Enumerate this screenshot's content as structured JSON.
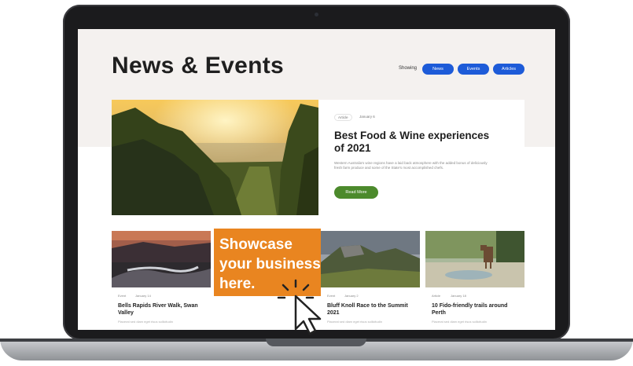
{
  "page": {
    "title": "News & Events",
    "filter": {
      "label": "Showing",
      "options": [
        "News",
        "Events",
        "Articles"
      ]
    }
  },
  "featured": {
    "tag": "Article",
    "date": "January 6",
    "title": "Best Food & Wine experiences of 2021",
    "description": "Western Australia's wine regions have a laid back atmosphere with the added bonus of deliciously fresh farm produce and some of the State's most accomplished chefs.",
    "button": "Read More"
  },
  "cards": [
    {
      "tag": "Event",
      "date": "January 14",
      "title": "Bells Rapids River Walk, Swan Valley",
      "desc": "Placerat sed diam eget risus sollicitudin"
    },
    {
      "tag": "Event",
      "date": "January 2",
      "title": "Bluff Knoll Race to the Summit 2021",
      "desc": "Placerat sed diam eget risus sollicitudin"
    },
    {
      "tag": "Article",
      "date": "January 18",
      "title": "10 Fido-friendly trails around Perth",
      "desc": "Placerat sed diam eget risus sollicitudin"
    }
  ],
  "promo": {
    "text": "Showcase your business here."
  },
  "colors": {
    "pill_blue": "#1d5bd8",
    "button_green": "#4c8a2c",
    "promo_orange": "#e98520"
  }
}
